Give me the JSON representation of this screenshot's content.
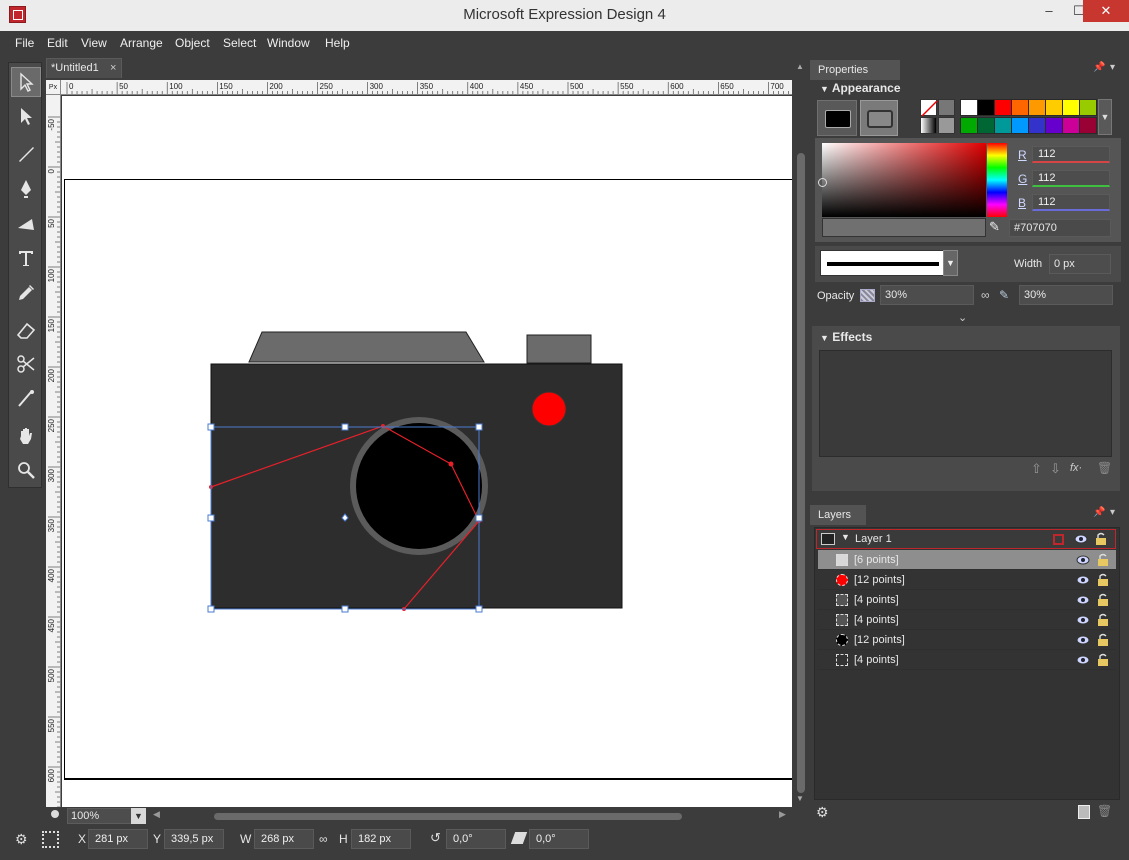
{
  "window": {
    "title": "Microsoft Expression Design 4",
    "minimize_label": "‒",
    "maximize_label": "☐",
    "close_label": "✕"
  },
  "menu": [
    "File",
    "Edit",
    "View",
    "Arrange",
    "Object",
    "Select",
    "Window",
    "Help"
  ],
  "document": {
    "tab_label": "*Untitled1",
    "tab_close": "×",
    "ruler_unit": "Px",
    "ruler_top_ticks": [
      "0",
      "50",
      "100",
      "150",
      "200",
      "250",
      "300",
      "350",
      "400",
      "450",
      "500",
      "550",
      "600",
      "650",
      "700"
    ],
    "ruler_left_ticks": [
      "-50",
      "0",
      "50",
      "100",
      "150",
      "200",
      "250",
      "300",
      "350",
      "400",
      "450",
      "500",
      "550",
      "600"
    ],
    "zoom": "100%"
  },
  "status": {
    "x_label": "X",
    "x_value": "281 px",
    "y_label": "Y",
    "y_value": "339,5 px",
    "w_label": "W",
    "w_value": "268 px",
    "h_label": "H",
    "h_value": "182 px",
    "rotate_value": "0,0°",
    "skew_value": "0,0°"
  },
  "properties": {
    "panel_title": "Properties",
    "appearance_title": "Appearance",
    "r_label": "R",
    "r_value": "112",
    "g_label": "G",
    "g_value": "112",
    "b_label": "B",
    "b_value": "112",
    "hex_value": "#707070",
    "width_label": "Width",
    "width_value": "0 px",
    "opacity_label": "Opacity",
    "opacity_value": "30%",
    "opacity2_value": "30%",
    "effects_title": "Effects",
    "palette_row1": [
      "#ffffff",
      "#000000",
      "#ff0000",
      "#ff6600",
      "#ff9900",
      "#ffcc00",
      "#ffff00",
      "#99cc00"
    ],
    "palette_row2": [
      "#00aa00",
      "#006633",
      "#009999",
      "#0099ff",
      "#3333cc",
      "#6600cc",
      "#cc0099",
      "#990033"
    ]
  },
  "layers": {
    "panel_title": "Layers",
    "layer_name": "Layer 1",
    "items": [
      {
        "label": "[6 points]",
        "color": "#d8d8d8"
      },
      {
        "label": "[12 points]",
        "color": "#ff0000"
      },
      {
        "label": "[4 points]",
        "color": "#555555"
      },
      {
        "label": "[4 points]",
        "color": "#555555"
      },
      {
        "label": "[12 points]",
        "color": "#000000"
      },
      {
        "label": "[4 points]",
        "color": "#333333"
      }
    ]
  },
  "colors": {
    "body_gray": "#2d2d2d",
    "accent_red": "#ff0000",
    "selection_blue": "#4a7bd0"
  }
}
